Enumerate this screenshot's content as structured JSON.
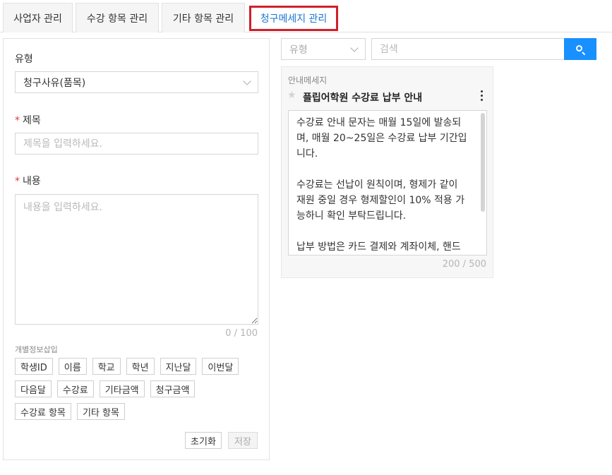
{
  "tabs": [
    {
      "label": "사업자 관리",
      "active": false
    },
    {
      "label": "수강 항목 관리",
      "active": false
    },
    {
      "label": "기타 항목 관리",
      "active": false
    },
    {
      "label": "청구메세지 관리",
      "active": true
    }
  ],
  "form": {
    "type_label": "유형",
    "type_value": "청구사유(품목)",
    "title_label": "제목",
    "title_placeholder": "제목을 입력하세요.",
    "content_label": "내용",
    "content_placeholder": "내용을 입력하세요.",
    "required_mark": "*",
    "counter": "0 / 100",
    "insert_label": "개별정보삽입",
    "insert_chips_row1": [
      "학생ID",
      "이름",
      "학교",
      "학년",
      "지난달",
      "이번달"
    ],
    "insert_chips_row2": [
      "다음달",
      "수강료",
      "기타금액",
      "청구금액"
    ],
    "insert_chips_row3": [
      "수강료 항목",
      "기타 항목"
    ],
    "reset_label": "초기화",
    "save_label": "저장"
  },
  "filter": {
    "type_placeholder": "유형",
    "search_placeholder": "검색"
  },
  "message_card": {
    "type": "안내메세지",
    "title": "플립어학원 수강료 납부 안내",
    "body": "수강료 안내 문자는 매월 15일에 발송되며, 매월 20~25일은 수강료 납부 기간입니다.\n\n수강료는 선납이 원칙이며, 형제가 같이 재원 중일 경우 형제할인이 10% 적용 가능하니 확인 부탁드립니다.\n\n납부 방법은 카드 결제와 계좌이체, 핸드폰 비대면 결제가 가능하며, 계좌이체를 원하",
    "counter": "200 / 500"
  },
  "icons": {
    "search": "search-icon",
    "star": "star-icon",
    "more": "more-vertical-icon",
    "chevron": "chevron-down-icon"
  },
  "colors": {
    "accent": "#1890ff",
    "active_tab_border": "#d0202a",
    "active_tab_text": "#1976d2",
    "required": "#e53935"
  }
}
